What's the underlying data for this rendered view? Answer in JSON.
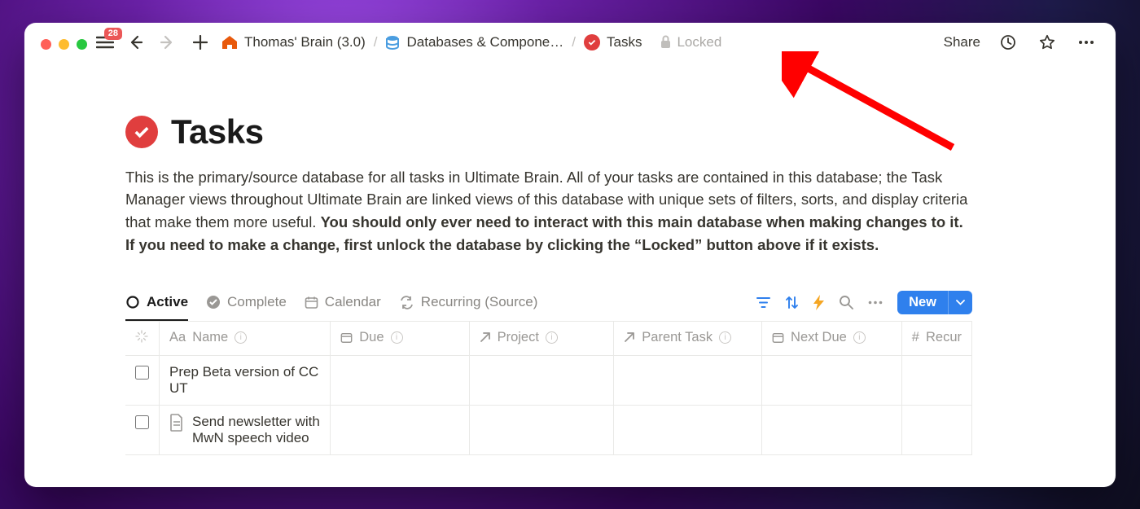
{
  "window": {
    "badge_count": "28",
    "breadcrumbs": [
      {
        "icon": "home",
        "label": "Thomas' Brain (3.0)"
      },
      {
        "icon": "database",
        "label": "Databases & Compone…"
      },
      {
        "icon": "check-badge",
        "label": "Tasks"
      }
    ],
    "locked_label": "Locked",
    "share_label": "Share"
  },
  "page": {
    "title": "Tasks",
    "description_plain": "This is the primary/source database for all tasks in Ultimate Brain. All of your tasks are contained in this database; the Task Manager views throughout Ultimate Brain are linked views of this database with unique sets of filters, sorts, and display criteria that make them more useful. ",
    "description_bold": "You should only ever need to interact with this main database when making changes to it. If you need to make a change, first unlock the database by clicking the “Locked” button above if it exists."
  },
  "database": {
    "tabs": [
      {
        "icon": "circle-empty",
        "label": "Active",
        "active": true
      },
      {
        "icon": "check-filled",
        "label": "Complete",
        "active": false
      },
      {
        "icon": "calendar",
        "label": "Calendar",
        "active": false
      },
      {
        "icon": "recurring",
        "label": "Recurring (Source)",
        "active": false
      }
    ],
    "new_button": "New",
    "columns": [
      {
        "icon": "text",
        "label": "Name"
      },
      {
        "icon": "calendar",
        "label": "Due"
      },
      {
        "icon": "arrow-up-right",
        "label": "Project"
      },
      {
        "icon": "arrow-up-right",
        "label": "Parent Task"
      },
      {
        "icon": "calendar",
        "label": "Next Due"
      },
      {
        "icon": "number",
        "label": "Recur"
      }
    ],
    "rows": [
      {
        "has_page_icon": false,
        "name": "Prep Beta version of CC UT"
      },
      {
        "has_page_icon": true,
        "name": "Send newsletter with MwN speech video"
      }
    ]
  }
}
